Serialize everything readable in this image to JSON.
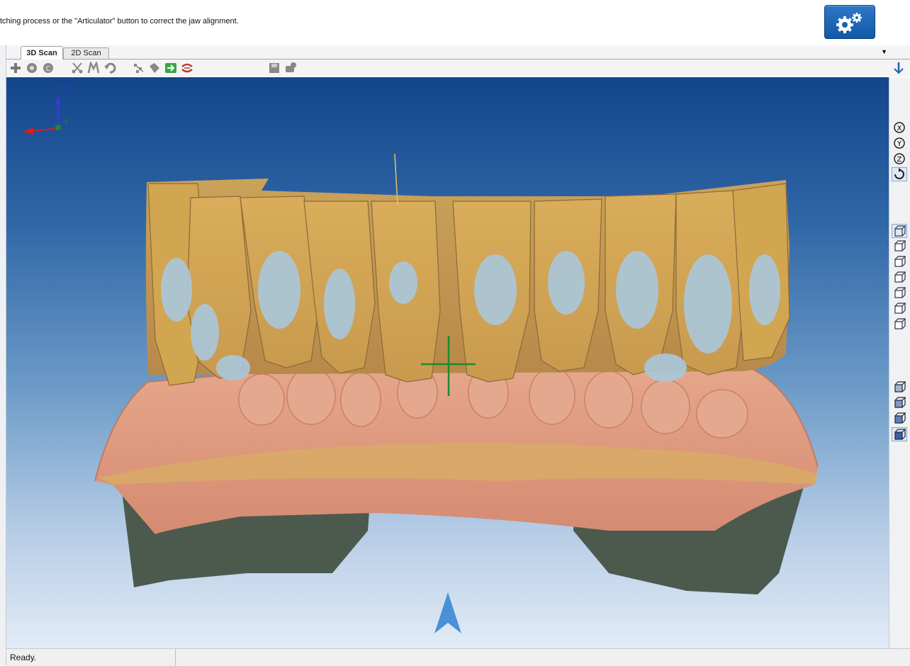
{
  "instruction": "tching process or the \"Articulator\" button to correct the jaw alignment.",
  "tabs": [
    {
      "label": "3D Scan",
      "active": true
    },
    {
      "label": "2D Scan",
      "active": false
    }
  ],
  "axes": {
    "z": "Z",
    "y": "Y"
  },
  "status": "Ready.",
  "colors": {
    "accent": "#1a62b0",
    "viewport_top": "#13458c",
    "viewport_bottom": "#e2ecf7",
    "tooth_gold": "#d6a64e",
    "tooth_blue": "#a9c8dc",
    "gum_pink": "#e0957a",
    "model_shadow": "#4b5a4d"
  },
  "toolbar_icons": [
    "add-icon",
    "record-icon",
    "replay-icon",
    "cut-icon",
    "cut-selection-icon",
    "undo-icon",
    "align-icon",
    "fill-icon",
    "export-icon",
    "articulator-icon",
    "save-icon",
    "snapshot-icon"
  ],
  "side_icons": [
    "view-x-icon",
    "view-y-icon",
    "view-z-icon",
    "rotate-view-icon",
    "view-front-icon",
    "view-back-icon",
    "view-left-icon",
    "view-right-icon",
    "view-top-icon",
    "view-bottom-icon",
    "view-iso-icon",
    "render-mode-1-icon",
    "render-mode-2-icon",
    "render-mode-3-icon",
    "render-mode-4-icon"
  ]
}
